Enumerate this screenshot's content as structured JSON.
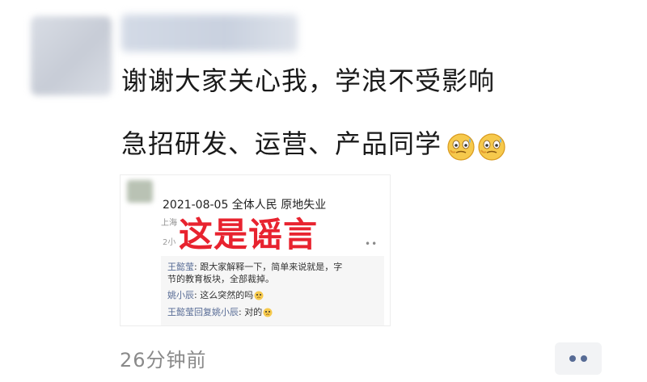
{
  "post": {
    "line1": "谢谢大家关心我，学浪不受影响",
    "line2": "急招研发、运营、产品同学",
    "timestamp": "26分钟前"
  },
  "embedded": {
    "header": "2021-08-05 全体人民 原地失业",
    "location": "上海",
    "time": "2小",
    "stamp_text": "这是谣言",
    "comments": [
      {
        "author": "王懿莹",
        "text": ": 跟大家解释一下，简单来说就是，字",
        "cont": "节的教育板块，全部裁掉。"
      },
      {
        "author": "姚小辰",
        "text": ": 这么突然的吗"
      },
      {
        "author": "王懿莹回复姚小辰",
        "text": ": 对的"
      }
    ]
  },
  "icons": {
    "emoji": "cold-sweat-emoji",
    "more": "more-dots-icon"
  },
  "colors": {
    "stamp": "#e8232f",
    "link": "#576b95",
    "timestamp": "#8a8a8a"
  }
}
